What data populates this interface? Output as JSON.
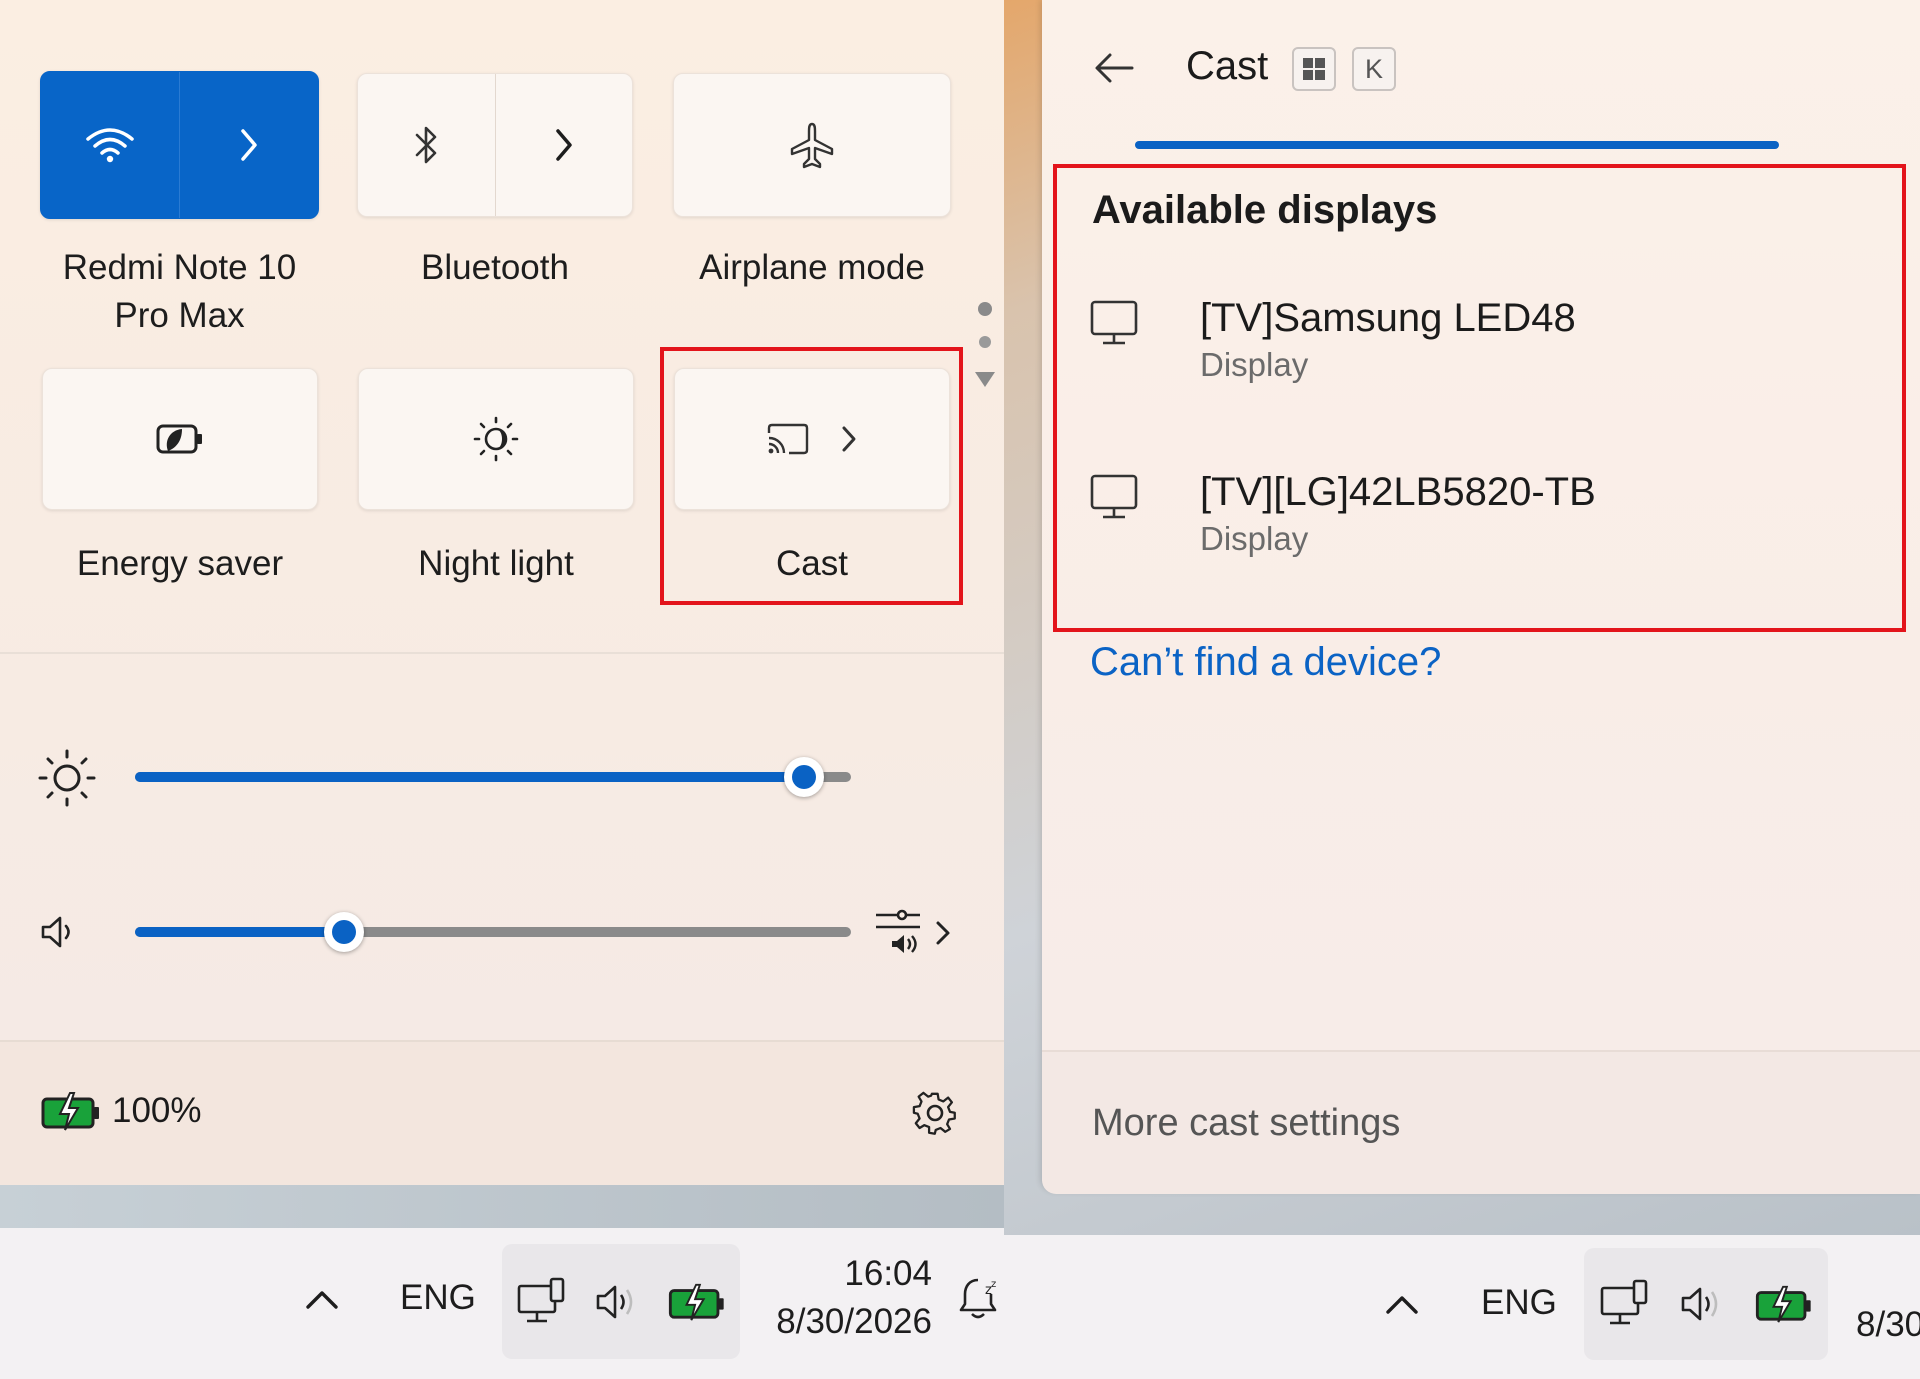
{
  "quick_settings": {
    "tiles": [
      {
        "label": "Redmi Note 10 Pro Max",
        "icon": "wifi-icon",
        "state": "on"
      },
      {
        "label": "Bluetooth",
        "icon": "bluetooth-icon",
        "state": "off"
      },
      {
        "label": "Airplane mode",
        "icon": "airplane-icon",
        "state": "off"
      },
      {
        "label": "Energy saver",
        "icon": "energy-saver-icon",
        "state": "off"
      },
      {
        "label": "Night light",
        "icon": "night-light-icon",
        "state": "off"
      },
      {
        "label": "Cast",
        "icon": "cast-icon",
        "state": "off",
        "highlighted": true
      }
    ],
    "brightness": 0.96,
    "volume": 0.28,
    "battery_text": "100%"
  },
  "taskbar": {
    "language": "ENG",
    "time": "16:04",
    "date": "8/30/2026",
    "date_cropped": "8/30"
  },
  "cast_panel": {
    "title": "Cast",
    "shortcut_keys": [
      "K"
    ],
    "section_title": "Available displays",
    "devices": [
      {
        "name": "[TV]Samsung LED48",
        "type": "Display"
      },
      {
        "name": "[TV][LG]42LB5820-TB",
        "type": "Display"
      }
    ],
    "help_link": "Can’t find a device?",
    "footer_link": "More cast settings"
  },
  "colors": {
    "accent": "#0a62c4",
    "highlight_box": "#e3141b",
    "link": "#0b63c5",
    "battery_green": "#19a23a"
  }
}
